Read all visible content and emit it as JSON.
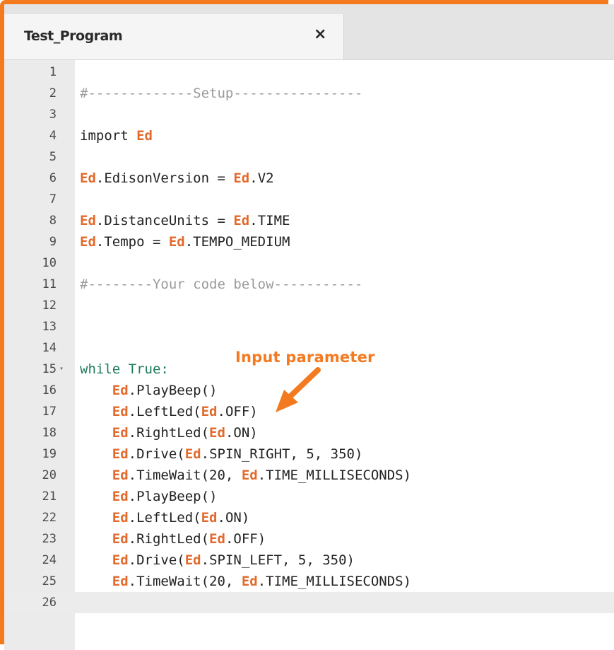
{
  "tab": {
    "title": "Test_Program",
    "close_icon": "×"
  },
  "annotation": {
    "label": "Input parameter",
    "color": "#f47a20"
  },
  "editor": {
    "active_line": 26,
    "lines": [
      {
        "n": "1",
        "tokens": []
      },
      {
        "n": "2",
        "tokens": [
          {
            "t": "#-------------Setup----------------",
            "c": "cmt"
          }
        ]
      },
      {
        "n": "3",
        "tokens": []
      },
      {
        "n": "4",
        "tokens": [
          {
            "t": "import ",
            "c": ""
          },
          {
            "t": "Ed",
            "c": "ed"
          }
        ]
      },
      {
        "n": "5",
        "tokens": []
      },
      {
        "n": "6",
        "tokens": [
          {
            "t": "Ed",
            "c": "ed"
          },
          {
            "t": ".EdisonVersion = ",
            "c": ""
          },
          {
            "t": "Ed",
            "c": "ed"
          },
          {
            "t": ".V2",
            "c": ""
          }
        ]
      },
      {
        "n": "7",
        "tokens": []
      },
      {
        "n": "8",
        "tokens": [
          {
            "t": "Ed",
            "c": "ed"
          },
          {
            "t": ".DistanceUnits = ",
            "c": ""
          },
          {
            "t": "Ed",
            "c": "ed"
          },
          {
            "t": ".TIME",
            "c": ""
          }
        ]
      },
      {
        "n": "9",
        "tokens": [
          {
            "t": "Ed",
            "c": "ed"
          },
          {
            "t": ".Tempo = ",
            "c": ""
          },
          {
            "t": "Ed",
            "c": "ed"
          },
          {
            "t": ".TEMPO_MEDIUM",
            "c": ""
          }
        ]
      },
      {
        "n": "10",
        "tokens": []
      },
      {
        "n": "11",
        "tokens": [
          {
            "t": "#--------Your code below-----------",
            "c": "cmt"
          }
        ]
      },
      {
        "n": "12",
        "tokens": []
      },
      {
        "n": "13",
        "tokens": []
      },
      {
        "n": "14",
        "tokens": []
      },
      {
        "n": "15",
        "fold": true,
        "tokens": [
          {
            "t": "while True:",
            "c": "kw"
          }
        ]
      },
      {
        "n": "16",
        "tokens": [
          {
            "t": "    ",
            "c": ""
          },
          {
            "t": "Ed",
            "c": "ed"
          },
          {
            "t": ".PlayBeep()",
            "c": ""
          }
        ]
      },
      {
        "n": "17",
        "tokens": [
          {
            "t": "    ",
            "c": ""
          },
          {
            "t": "Ed",
            "c": "ed"
          },
          {
            "t": ".LeftLed(",
            "c": ""
          },
          {
            "t": "Ed",
            "c": "ed"
          },
          {
            "t": ".OFF)",
            "c": ""
          }
        ]
      },
      {
        "n": "18",
        "tokens": [
          {
            "t": "    ",
            "c": ""
          },
          {
            "t": "Ed",
            "c": "ed"
          },
          {
            "t": ".RightLed(",
            "c": ""
          },
          {
            "t": "Ed",
            "c": "ed"
          },
          {
            "t": ".ON)",
            "c": ""
          }
        ]
      },
      {
        "n": "19",
        "tokens": [
          {
            "t": "    ",
            "c": ""
          },
          {
            "t": "Ed",
            "c": "ed"
          },
          {
            "t": ".Drive(",
            "c": ""
          },
          {
            "t": "Ed",
            "c": "ed"
          },
          {
            "t": ".SPIN_RIGHT, 5, 350)",
            "c": ""
          }
        ]
      },
      {
        "n": "20",
        "tokens": [
          {
            "t": "    ",
            "c": ""
          },
          {
            "t": "Ed",
            "c": "ed"
          },
          {
            "t": ".TimeWait(20, ",
            "c": ""
          },
          {
            "t": "Ed",
            "c": "ed"
          },
          {
            "t": ".TIME_MILLISECONDS)",
            "c": ""
          }
        ]
      },
      {
        "n": "21",
        "tokens": [
          {
            "t": "    ",
            "c": ""
          },
          {
            "t": "Ed",
            "c": "ed"
          },
          {
            "t": ".PlayBeep()",
            "c": ""
          }
        ]
      },
      {
        "n": "22",
        "tokens": [
          {
            "t": "    ",
            "c": ""
          },
          {
            "t": "Ed",
            "c": "ed"
          },
          {
            "t": ".LeftLed(",
            "c": ""
          },
          {
            "t": "Ed",
            "c": "ed"
          },
          {
            "t": ".ON)",
            "c": ""
          }
        ]
      },
      {
        "n": "23",
        "tokens": [
          {
            "t": "    ",
            "c": ""
          },
          {
            "t": "Ed",
            "c": "ed"
          },
          {
            "t": ".RightLed(",
            "c": ""
          },
          {
            "t": "Ed",
            "c": "ed"
          },
          {
            "t": ".OFF)",
            "c": ""
          }
        ]
      },
      {
        "n": "24",
        "tokens": [
          {
            "t": "    ",
            "c": ""
          },
          {
            "t": "Ed",
            "c": "ed"
          },
          {
            "t": ".Drive(",
            "c": ""
          },
          {
            "t": "Ed",
            "c": "ed"
          },
          {
            "t": ".SPIN_LEFT, 5, 350)",
            "c": ""
          }
        ]
      },
      {
        "n": "25",
        "tokens": [
          {
            "t": "    ",
            "c": ""
          },
          {
            "t": "Ed",
            "c": "ed"
          },
          {
            "t": ".TimeWait(20, ",
            "c": ""
          },
          {
            "t": "Ed",
            "c": "ed"
          },
          {
            "t": ".TIME_MILLISECONDS)",
            "c": ""
          }
        ]
      },
      {
        "n": "26",
        "tokens": []
      }
    ]
  },
  "colors": {
    "accent_orange": "#f47a20",
    "ed_token": "#e26a2c",
    "comment": "#9a9a9a",
    "keyword": "#1f7a5a"
  }
}
